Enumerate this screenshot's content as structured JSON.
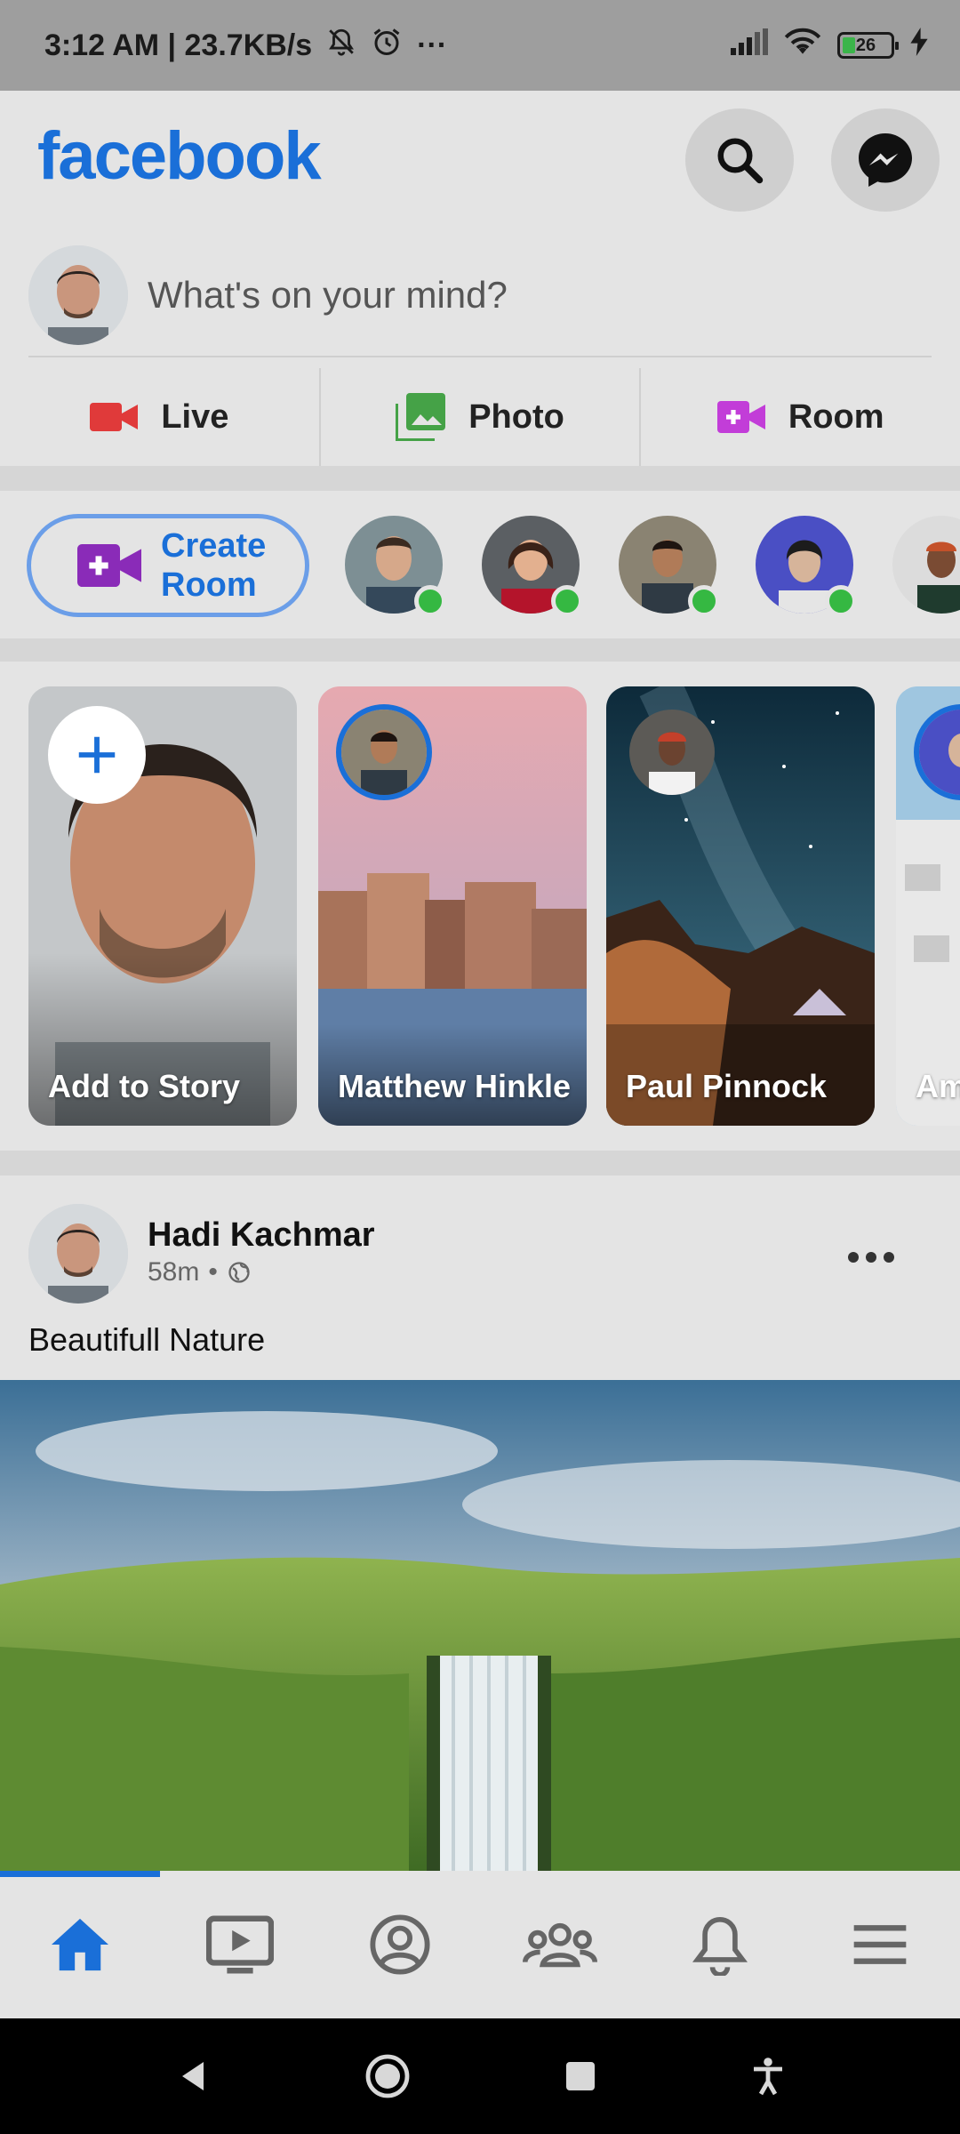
{
  "status_bar": {
    "time_speed": "3:12 AM | 23.7KB/s",
    "more": "···",
    "battery": "26"
  },
  "header": {
    "logo": "facebook"
  },
  "composer": {
    "placeholder": "What's on your mind?",
    "actions": [
      {
        "label": "Live",
        "icon": "video-camera-icon",
        "color": "#e03a3a"
      },
      {
        "label": "Photo",
        "icon": "photo-icon",
        "color": "#45a247"
      },
      {
        "label": "Room",
        "icon": "room-video-icon",
        "color": "#c23dd8"
      }
    ]
  },
  "rooms": {
    "create_label_1": "Create",
    "create_label_2": "Room"
  },
  "stories": [
    {
      "name": "Add to Story"
    },
    {
      "name": "Matthew Hinkle"
    },
    {
      "name": "Paul Pinnock"
    },
    {
      "name": "Am"
    }
  ],
  "post": {
    "author": "Hadi Kachmar",
    "time": "58m",
    "separator": "•",
    "caption": "Beautifull Nature"
  },
  "bottom_nav": {
    "items": [
      "home-icon",
      "watch-icon",
      "profile-icon",
      "groups-icon",
      "notifications-icon",
      "menu-icon"
    ],
    "active": "home-icon"
  },
  "colors": {
    "brand": "#1a6fd8",
    "online": "#35b842"
  }
}
